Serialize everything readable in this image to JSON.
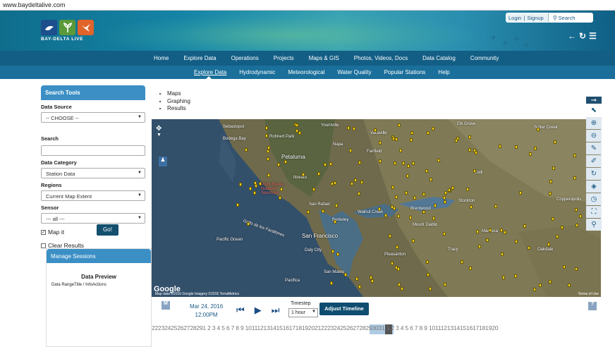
{
  "browser": {
    "url": "www.baydeltalive.com"
  },
  "brand": {
    "logo_text": "BAY-DELTA LIVE"
  },
  "account": {
    "login": "Login",
    "separator": "|",
    "signup": "Signup",
    "search_label": "Search"
  },
  "main_nav": [
    "Home",
    "Explore Data",
    "Operations",
    "Projects",
    "Maps & GIS",
    "Photos, Videos, Docs",
    "Data Catalog",
    "Community"
  ],
  "sub_nav": [
    "Explore Data",
    "Hydrodynamic",
    "Meteorological",
    "Water Quality",
    "Popular Stations",
    "Help"
  ],
  "sidebar": {
    "title": "Search Tools",
    "data_source_label": "Data Source",
    "data_source_value": "-- CHOOSE --",
    "search_label": "Search",
    "data_category_label": "Data Category",
    "data_category_value": "Station Data",
    "regions_label": "Regions",
    "regions_value": "Current Map Extent",
    "sensor_label": "Sensor",
    "sensor_value": "--- all ---",
    "map_it_label": "Map it",
    "map_it_checked": true,
    "go_label": "Go!",
    "clear_results_label": "Clear Results",
    "clear_results_checked": false
  },
  "sessions": {
    "title": "Manage Sessions",
    "preview_title": "Data Preview",
    "preview_columns": "Data RangeTitle / InfoActions"
  },
  "map_tabs": [
    "Maps",
    "Graphing",
    "Results"
  ],
  "map": {
    "google": "Google",
    "attribution": "Map data ©2016 Google Imagery ©2016 TerraMetrics",
    "terms": "Terms of Use",
    "places": [
      {
        "name": "Sebastopol",
        "big": false
      },
      {
        "name": "Rohnert Park",
        "big": false
      },
      {
        "name": "Bodega Bay",
        "big": false
      },
      {
        "name": "Petaluma",
        "big": true
      },
      {
        "name": "Novato",
        "big": false
      },
      {
        "name": "Point Reyes National Seashore",
        "big": false
      },
      {
        "name": "San Rafael",
        "big": false
      },
      {
        "name": "Berkeley",
        "big": false
      },
      {
        "name": "San Francisco",
        "big": true
      },
      {
        "name": "Daly City",
        "big": false
      },
      {
        "name": "San Mateo",
        "big": false
      },
      {
        "name": "Pacifica",
        "big": false
      },
      {
        "name": "Walnut Creek",
        "big": false
      },
      {
        "name": "Pleasanton",
        "big": false
      },
      {
        "name": "Brentwood",
        "big": false
      },
      {
        "name": "Fairfield",
        "big": false
      },
      {
        "name": "Vacaville",
        "big": false
      },
      {
        "name": "Napa",
        "big": false
      },
      {
        "name": "Yountville",
        "big": false
      },
      {
        "name": "Elk Grove",
        "big": false
      },
      {
        "name": "Lodi",
        "big": false
      },
      {
        "name": "Stockton",
        "big": false
      },
      {
        "name": "Manteca",
        "big": false
      },
      {
        "name": "Tracy",
        "big": false
      },
      {
        "name": "Sutter Creek",
        "big": false
      },
      {
        "name": "Copperopolis",
        "big": false
      },
      {
        "name": "Oakdale",
        "big": false
      },
      {
        "name": "Pacific Ocean",
        "big": false
      },
      {
        "name": "Golfo de los Farallones",
        "big": false
      },
      {
        "name": "Mount Diablo",
        "big": false
      }
    ]
  },
  "timeline": {
    "m_label": "M",
    "date": "Mar 24, 2016",
    "time": "12:00PM",
    "timestep_label": "Timestep",
    "timestep_value": "1 hour",
    "adjust_label": "Adjust Timeline",
    "help_label": "?",
    "ticks": "22232425262728291  2  3  4  5  6  7  8  9  10111213141516171819202122232425262728293031 1  2  3  4  5  6  7  8  9  1011121314151617181920"
  },
  "colors": {
    "nav_dark": "#135e85",
    "nav_sub": "#1a6f9b",
    "panel_head": "#3b8fc5",
    "button": "#0e4d6f",
    "pin": "#f2d11a"
  },
  "icons": [
    "home-icon",
    "refresh-icon",
    "list-icon",
    "search-icon",
    "arrow-right-icon",
    "pointer-icon",
    "zoom-in-icon",
    "zoom-out-icon",
    "pencil-icon",
    "ruler-icon",
    "rotate-icon",
    "layers-icon",
    "clock-icon",
    "extent-icon",
    "magnifier-icon"
  ]
}
